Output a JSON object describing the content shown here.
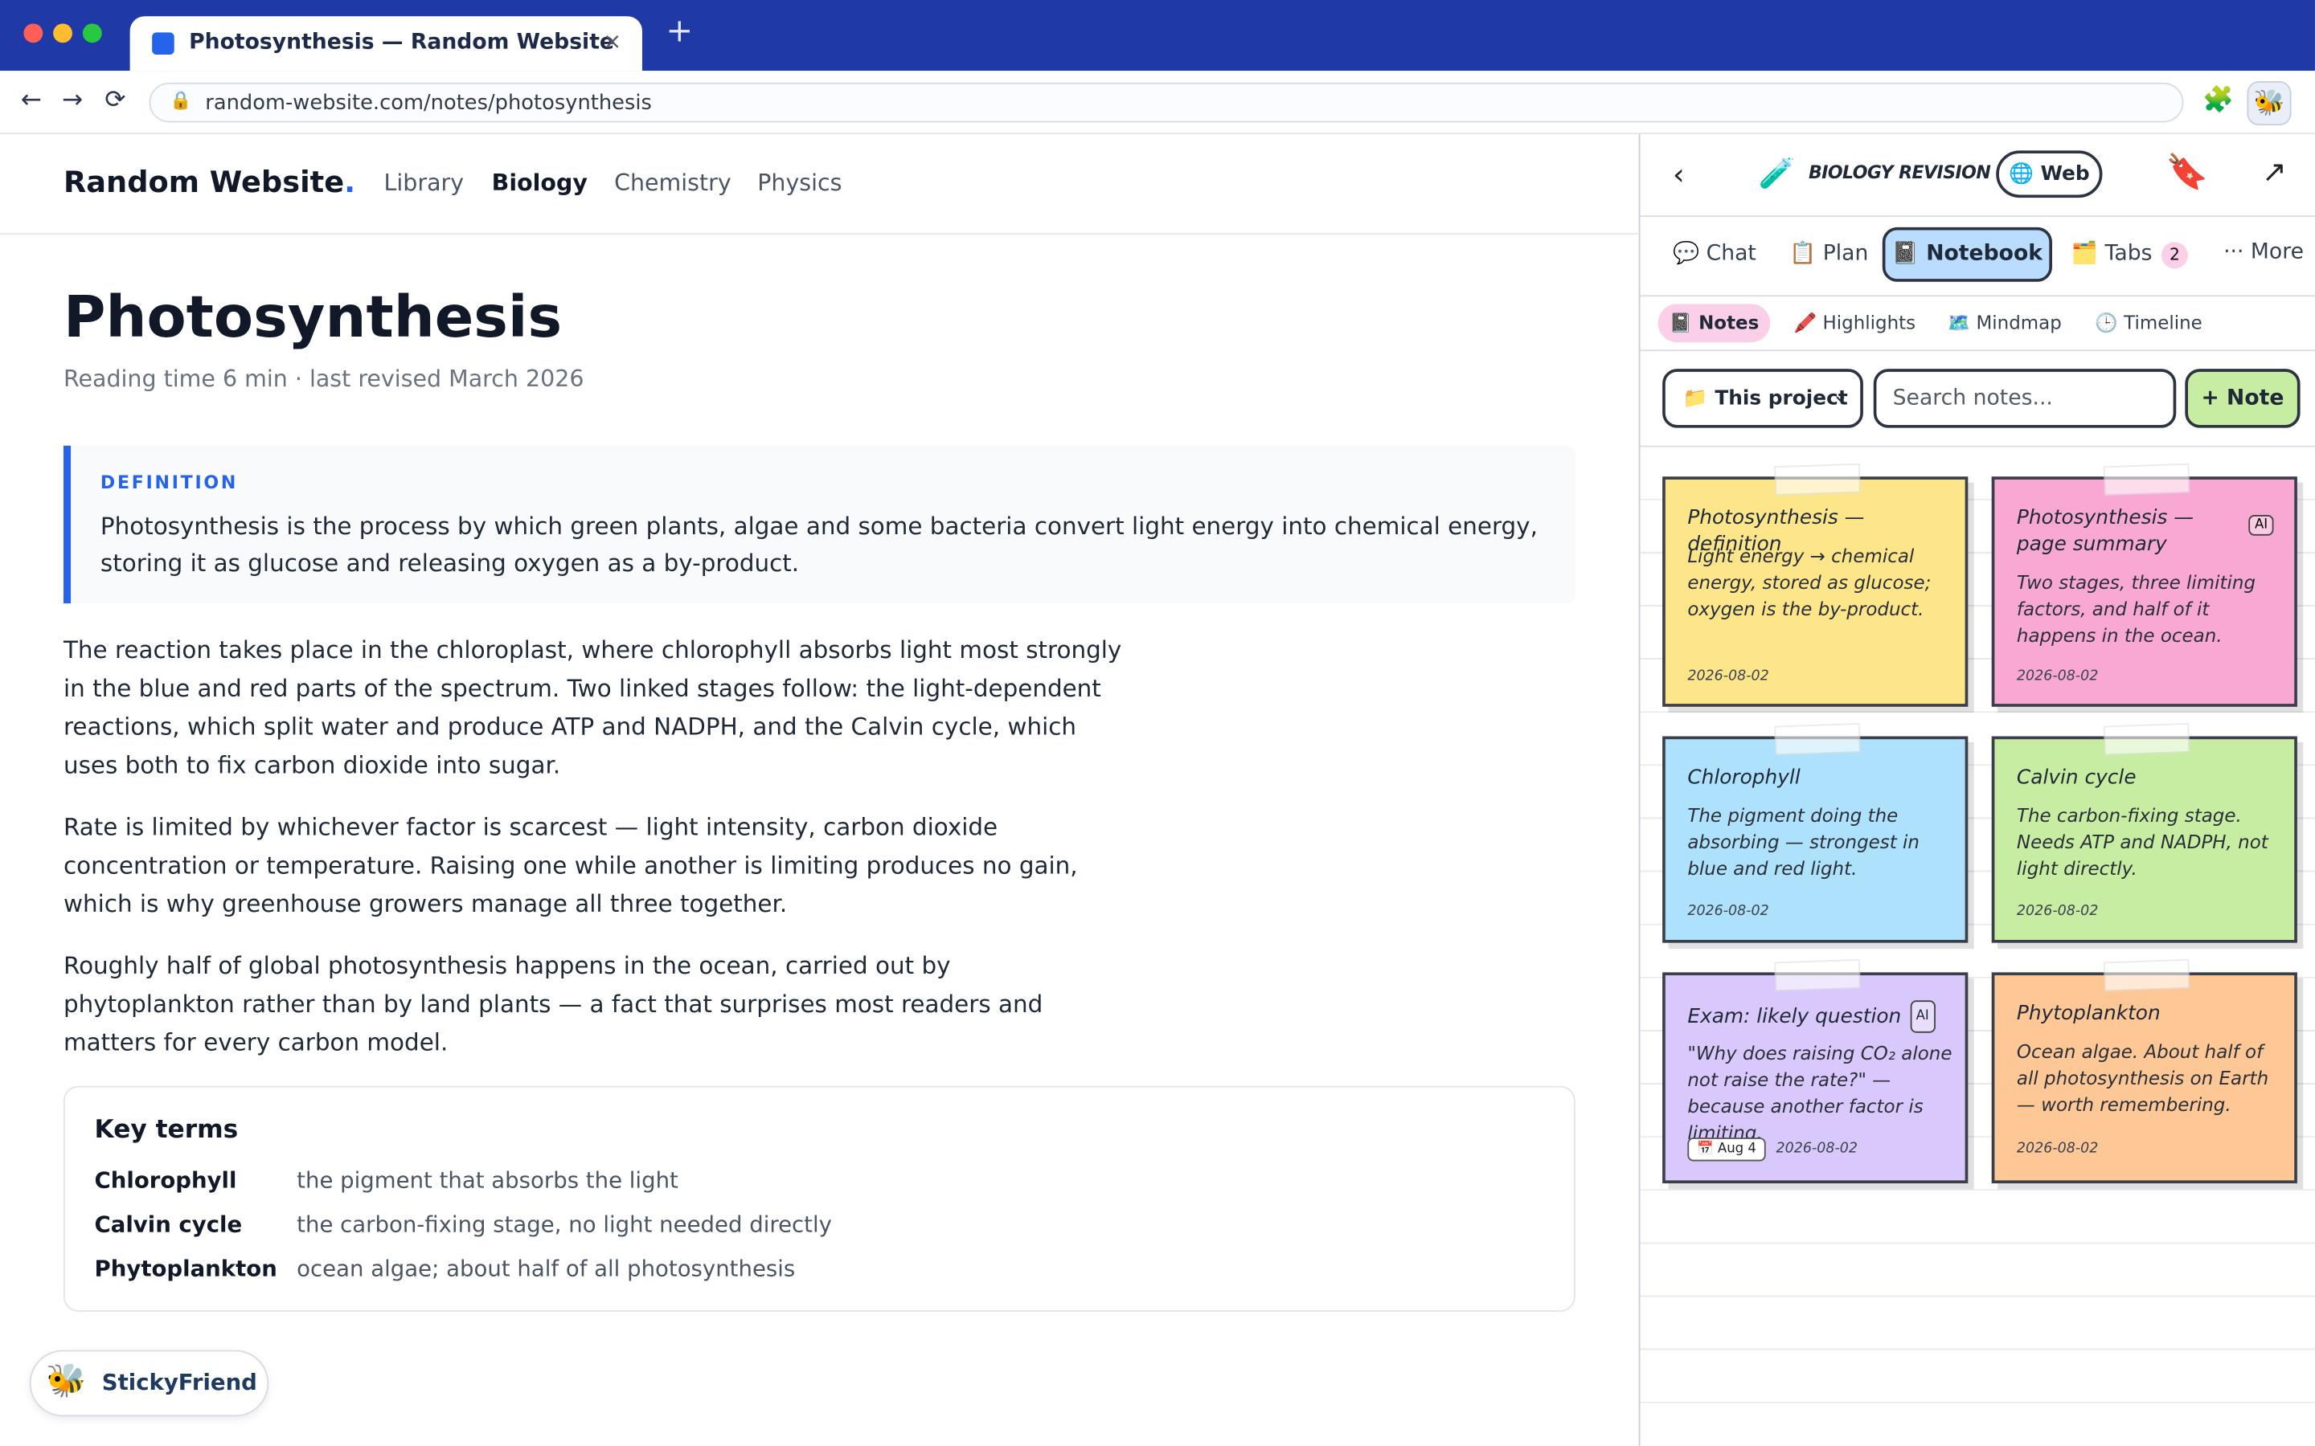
{
  "browser": {
    "tab_title": "Photosynthesis — Random Website",
    "tab_close": "×",
    "new_tab": "+",
    "back": "←",
    "forward": "→",
    "reload": "⟳",
    "url": "random-website.com/notes/photosynthesis",
    "colors": {
      "chrome": "#1f3aa6",
      "close": "#ff5f57",
      "minimize": "#febc2e",
      "zoom": "#28c840"
    }
  },
  "site": {
    "logo": "Random Website",
    "logo_dot": ".",
    "nav": [
      "Library",
      "Biology",
      "Chemistry",
      "Physics"
    ],
    "active_nav": "Biology"
  },
  "article": {
    "title": "Photosynthesis",
    "meta": "Reading time 6 min · last revised March 2026",
    "definition_label": "DEFINITION",
    "definition_text": "Photosynthesis is the process by which green plants, algae and some bacteria convert light energy into chemical energy, storing it as glucose and releasing oxygen as a by-product.",
    "paragraphs": [
      "The reaction takes place in the chloroplast, where chlorophyll absorbs light most strongly in the blue and red parts of the spectrum. Two linked stages follow: the light-dependent reactions, which split water and produce ATP and NADPH, and the Calvin cycle, which uses both to fix carbon dioxide into sugar.",
      "Rate is limited by whichever factor is scarcest — light intensity, carbon dioxide concentration or temperature. Raising one while another is limiting produces no gain, which is why greenhouse growers manage all three together.",
      "Roughly half of global photosynthesis happens in the ocean, carried out by phytoplankton rather than by land plants — a fact that surprises most readers and matters for every carbon model."
    ],
    "key_terms_title": "Key terms",
    "key_terms": [
      {
        "term": "Chlorophyll",
        "def": "the pigment that absorbs the light"
      },
      {
        "term": "Calvin cycle",
        "def": "the carbon-fixing stage, no light needed directly"
      },
      {
        "term": "Phytoplankton",
        "def": "ocean algae; about half of all photosynthesis"
      }
    ]
  },
  "stickyfriend": {
    "label": "StickyFriend"
  },
  "panel": {
    "back": "‹",
    "project_title": "BIOLOGY REVISION",
    "web_button": "🌐 Web",
    "expand": "↗",
    "tabs": [
      {
        "label": "💬 Chat"
      },
      {
        "label": "📋 Plan"
      },
      {
        "label": "📓 Notebook"
      },
      {
        "label": "🗂️ Tabs",
        "badge": "2"
      },
      {
        "label": "··· More"
      }
    ],
    "subtabs": [
      "📓 Notes",
      "🖍️ Highlights",
      "🗺️ Mindmap",
      "🕒 Timeline"
    ],
    "scope": "📁 This project",
    "scope_chevron": "⌄",
    "search_placeholder": "Search notes...",
    "add_note": "+ Note",
    "notes": [
      {
        "title": "Photosynthesis — definition",
        "body": "Light energy → chemical energy, stored as glucose; oxygen is the by-product.",
        "date": "2026-08-02",
        "color": "#fde68a"
      },
      {
        "title": "Photosynthesis — page summary",
        "ai": "AI",
        "body": "Two stages, three limiting factors, and half of it happens in the ocean.",
        "date": "2026-08-02",
        "color": "#f9a8d4"
      },
      {
        "title": "Chlorophyll",
        "body": "The pigment doing the absorbing — strongest in blue and red light.",
        "date": "2026-08-02",
        "color": "#aee1fb"
      },
      {
        "title": "Calvin cycle",
        "body": "The carbon-fixing stage. Needs ATP and NADPH, not light directly.",
        "date": "2026-08-02",
        "color": "#c7eda2"
      },
      {
        "title": "Exam: likely question",
        "ai": "AI",
        "body": "\"Why does raising CO₂ alone not raise the rate?\" — because another factor is limiting.",
        "due": "📅 Aug 4",
        "date": "2026-08-02",
        "color": "#d9c8fb"
      },
      {
        "title": "Phytoplankton",
        "body": "Ocean algae. About half of all photosynthesis on Earth — worth remembering.",
        "date": "2026-08-02",
        "color": "#fdc796"
      }
    ]
  }
}
